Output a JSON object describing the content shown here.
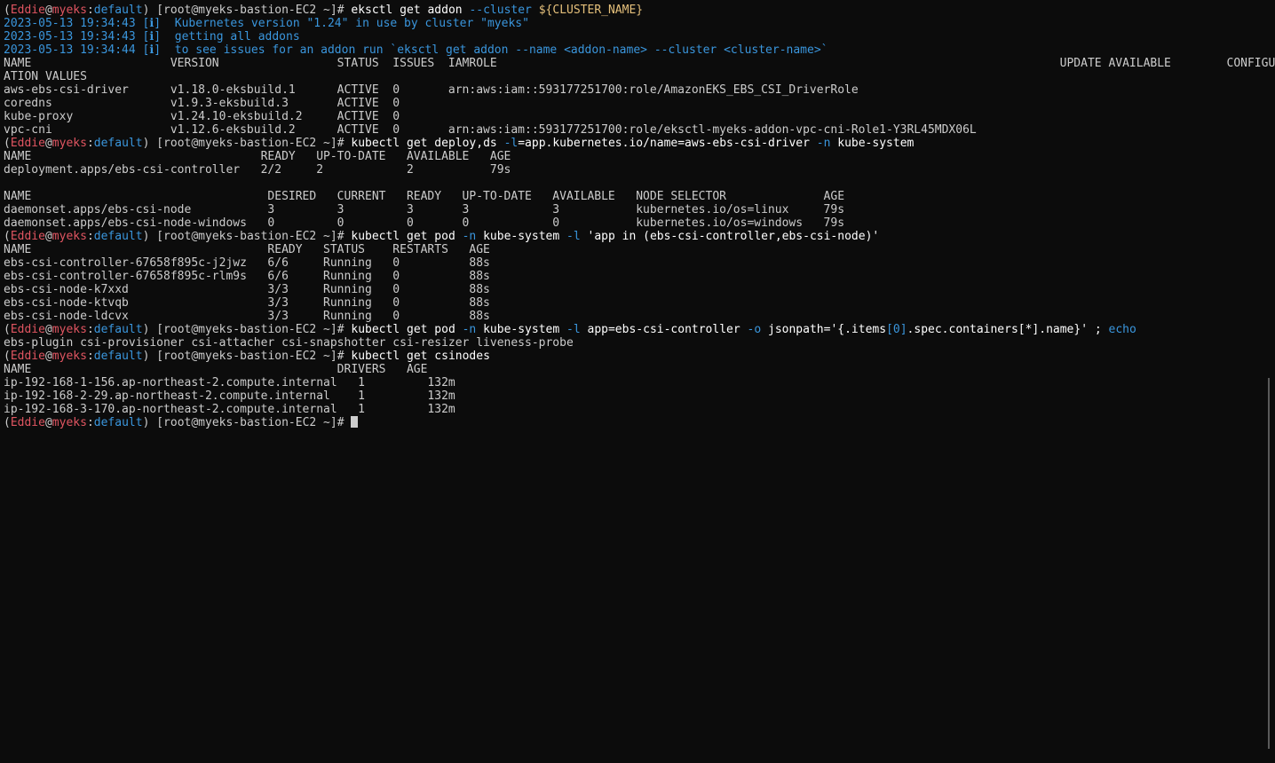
{
  "colors": {
    "background": "#0c0c0c",
    "default_text": "#cccccc",
    "prompt_user": "#e05561",
    "prompt_host": "#e05561",
    "prompt_context": "#3a96dd",
    "command": "#ffffff",
    "flag": "#3a96dd",
    "variable": "#e5c07b",
    "info_log": "#3a96dd",
    "highlight_cyan": "#3a96dd"
  },
  "terminal": {
    "lines": [
      [
        [
          "(",
          "#cccccc"
        ],
        [
          "Eddie",
          "#e05561"
        ],
        [
          "@",
          "#cccccc"
        ],
        [
          "myeks",
          "#e05561"
        ],
        [
          ":",
          "#cccccc"
        ],
        [
          "default",
          "#3a96dd"
        ],
        [
          ") [root@myeks-bastion-EC2 ~]# ",
          "#cccccc"
        ],
        [
          "eksctl get addon ",
          "#ffffff"
        ],
        [
          "--cluster",
          "#3a96dd"
        ],
        [
          " ",
          "#ffffff"
        ],
        [
          "${CLUSTER_NAME}",
          "#e5c07b"
        ]
      ],
      [
        [
          "2023-05-13 19:34:43 [ℹ]  Kubernetes version \"1.24\" in use by cluster \"myeks\"",
          "#3a96dd"
        ]
      ],
      [
        [
          "2023-05-13 19:34:43 [ℹ]  getting all addons",
          "#3a96dd"
        ]
      ],
      [
        [
          "2023-05-13 19:34:44 [ℹ]  to see issues for an addon run `eksctl get addon --name <addon-name> --cluster <cluster-name>`",
          "#3a96dd"
        ]
      ],
      [
        [
          "NAME                    VERSION                 STATUS  ISSUES  IAMROLE                                                                                 UPDATE AVAILABLE        CONFIGUR",
          "#cccccc"
        ]
      ],
      [
        [
          "ATION VALUES",
          "#cccccc"
        ]
      ],
      [
        [
          "aws-ebs-csi-driver      v1.18.0-eksbuild.1      ACTIVE  0       arn:aws:iam::593177251700:role/AmazonEKS_EBS_CSI_DriverRole",
          "#cccccc"
        ]
      ],
      [
        [
          "coredns                 v1.9.3-eksbuild.3       ACTIVE  0",
          "#cccccc"
        ]
      ],
      [
        [
          "kube-proxy              v1.24.10-eksbuild.2     ACTIVE  0",
          "#cccccc"
        ]
      ],
      [
        [
          "vpc-cni                 v1.12.6-eksbuild.2      ACTIVE  0       arn:aws:iam::593177251700:role/eksctl-myeks-addon-vpc-cni-Role1-Y3RL45MDX06L",
          "#cccccc"
        ]
      ],
      [
        [
          "(",
          "#cccccc"
        ],
        [
          "Eddie",
          "#e05561"
        ],
        [
          "@",
          "#cccccc"
        ],
        [
          "myeks",
          "#e05561"
        ],
        [
          ":",
          "#cccccc"
        ],
        [
          "default",
          "#3a96dd"
        ],
        [
          ") [root@myeks-bastion-EC2 ~]# ",
          "#cccccc"
        ],
        [
          "kubectl get deploy,ds ",
          "#ffffff"
        ],
        [
          "-l",
          "#3a96dd"
        ],
        [
          "=app.kubernetes.io/name=aws-ebs-csi-driver ",
          "#ffffff"
        ],
        [
          "-n",
          "#3a96dd"
        ],
        [
          " kube-system",
          "#ffffff"
        ]
      ],
      [
        [
          "NAME                                 READY   UP-TO-DATE   AVAILABLE   AGE",
          "#cccccc"
        ]
      ],
      [
        [
          "deployment.apps/ebs-csi-controller   2/2     2            2           79s",
          "#cccccc"
        ]
      ],
      [
        [
          "",
          "#cccccc"
        ]
      ],
      [
        [
          "NAME                                  DESIRED   CURRENT   READY   UP-TO-DATE   AVAILABLE   NODE SELECTOR              AGE",
          "#cccccc"
        ]
      ],
      [
        [
          "daemonset.apps/ebs-csi-node           3         3         3       3            3           kubernetes.io/os=linux     79s",
          "#cccccc"
        ]
      ],
      [
        [
          "daemonset.apps/ebs-csi-node-windows   0         0         0       0            0           kubernetes.io/os=windows   79s",
          "#cccccc"
        ]
      ],
      [
        [
          "(",
          "#cccccc"
        ],
        [
          "Eddie",
          "#e05561"
        ],
        [
          "@",
          "#cccccc"
        ],
        [
          "myeks",
          "#e05561"
        ],
        [
          ":",
          "#cccccc"
        ],
        [
          "default",
          "#3a96dd"
        ],
        [
          ") [root@myeks-bastion-EC2 ~]# ",
          "#cccccc"
        ],
        [
          "kubectl get pod ",
          "#ffffff"
        ],
        [
          "-n",
          "#3a96dd"
        ],
        [
          " kube-system ",
          "#ffffff"
        ],
        [
          "-l",
          "#3a96dd"
        ],
        [
          " 'app in (ebs-csi-controller,ebs-csi-node)'",
          "#ffffff"
        ]
      ],
      [
        [
          "NAME                                  READY   STATUS    RESTARTS   AGE",
          "#cccccc"
        ]
      ],
      [
        [
          "ebs-csi-controller-67658f895c-j2jwz   6/6     Running   0          88s",
          "#cccccc"
        ]
      ],
      [
        [
          "ebs-csi-controller-67658f895c-rlm9s   6/6     Running   0          88s",
          "#cccccc"
        ]
      ],
      [
        [
          "ebs-csi-node-k7xxd                    3/3     Running   0          88s",
          "#cccccc"
        ]
      ],
      [
        [
          "ebs-csi-node-ktvqb                    3/3     Running   0          88s",
          "#cccccc"
        ]
      ],
      [
        [
          "ebs-csi-node-ldcvx                    3/3     Running   0          88s",
          "#cccccc"
        ]
      ],
      [
        [
          "(",
          "#cccccc"
        ],
        [
          "Eddie",
          "#e05561"
        ],
        [
          "@",
          "#cccccc"
        ],
        [
          "myeks",
          "#e05561"
        ],
        [
          ":",
          "#cccccc"
        ],
        [
          "default",
          "#3a96dd"
        ],
        [
          ") [root@myeks-bastion-EC2 ~]# ",
          "#cccccc"
        ],
        [
          "kubectl get pod ",
          "#ffffff"
        ],
        [
          "-n",
          "#3a96dd"
        ],
        [
          " kube-system ",
          "#ffffff"
        ],
        [
          "-l",
          "#3a96dd"
        ],
        [
          " app=ebs-csi-controller ",
          "#ffffff"
        ],
        [
          "-o",
          "#3a96dd"
        ],
        [
          " jsonpath='{.items",
          "#ffffff"
        ],
        [
          "[0]",
          "#3a96dd"
        ],
        [
          ".spec.containers[*].name}' ; ",
          "#ffffff"
        ],
        [
          "echo",
          "#3a96dd"
        ]
      ],
      [
        [
          "ebs-plugin csi-provisioner csi-attacher csi-snapshotter csi-resizer liveness-probe",
          "#cccccc"
        ]
      ],
      [
        [
          "(",
          "#cccccc"
        ],
        [
          "Eddie",
          "#e05561"
        ],
        [
          "@",
          "#cccccc"
        ],
        [
          "myeks",
          "#e05561"
        ],
        [
          ":",
          "#cccccc"
        ],
        [
          "default",
          "#3a96dd"
        ],
        [
          ") [root@myeks-bastion-EC2 ~]# ",
          "#cccccc"
        ],
        [
          "kubectl get csinodes",
          "#ffffff"
        ]
      ],
      [
        [
          "NAME                                            DRIVERS   AGE",
          "#cccccc"
        ]
      ],
      [
        [
          "ip-192-168-1-156.ap-northeast-2.compute.internal   1         132m",
          "#cccccc"
        ]
      ],
      [
        [
          "ip-192-168-2-29.ap-northeast-2.compute.internal    1         132m",
          "#cccccc"
        ]
      ],
      [
        [
          "ip-192-168-3-170.ap-northeast-2.compute.internal   1         132m",
          "#cccccc"
        ]
      ],
      [
        [
          "(",
          "#cccccc"
        ],
        [
          "Eddie",
          "#e05561"
        ],
        [
          "@",
          "#cccccc"
        ],
        [
          "myeks",
          "#e05561"
        ],
        [
          ":",
          "#cccccc"
        ],
        [
          "default",
          "#3a96dd"
        ],
        [
          ") [root@myeks-bastion-EC2 ~]# ",
          "#cccccc"
        ]
      ]
    ]
  }
}
